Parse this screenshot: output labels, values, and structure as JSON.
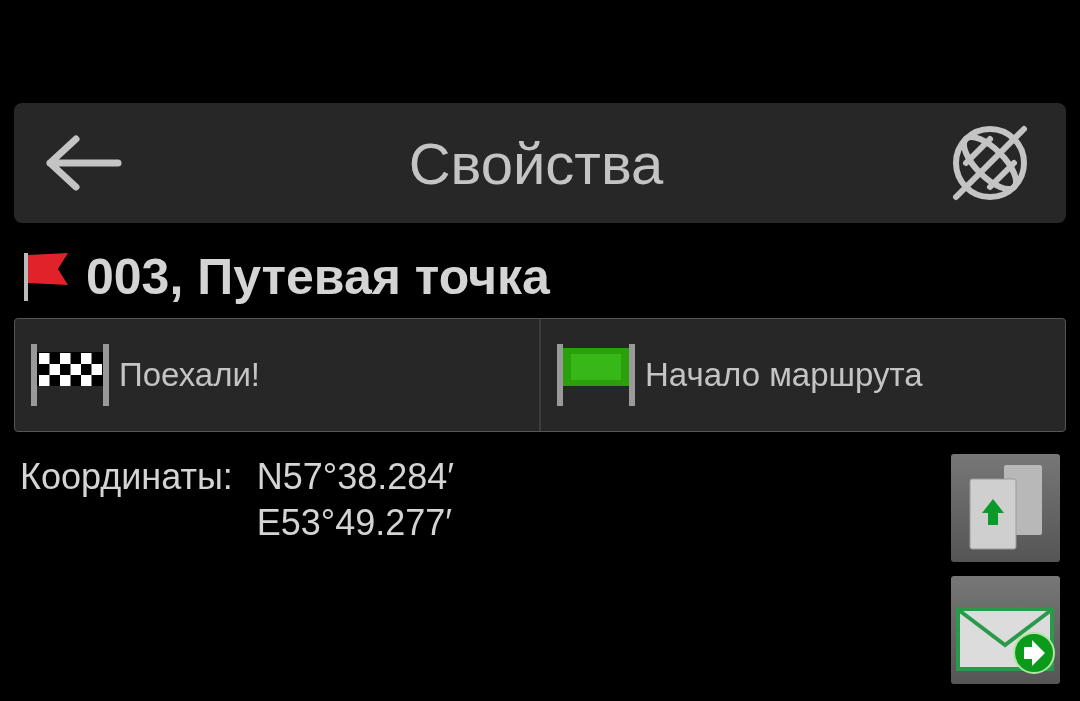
{
  "header": {
    "title": "Свойства"
  },
  "waypoint": {
    "title": "003, Путевая точка"
  },
  "actions": [
    {
      "kind": "go",
      "label": "Поехали!"
    },
    {
      "kind": "start",
      "label": "Начало маршрута"
    }
  ],
  "coordinates": {
    "label": "Координаты:",
    "lines": [
      "N57°38.284′",
      "E53°49.277′"
    ]
  },
  "side_buttons": [
    {
      "kind": "copy"
    },
    {
      "kind": "send"
    }
  ]
}
